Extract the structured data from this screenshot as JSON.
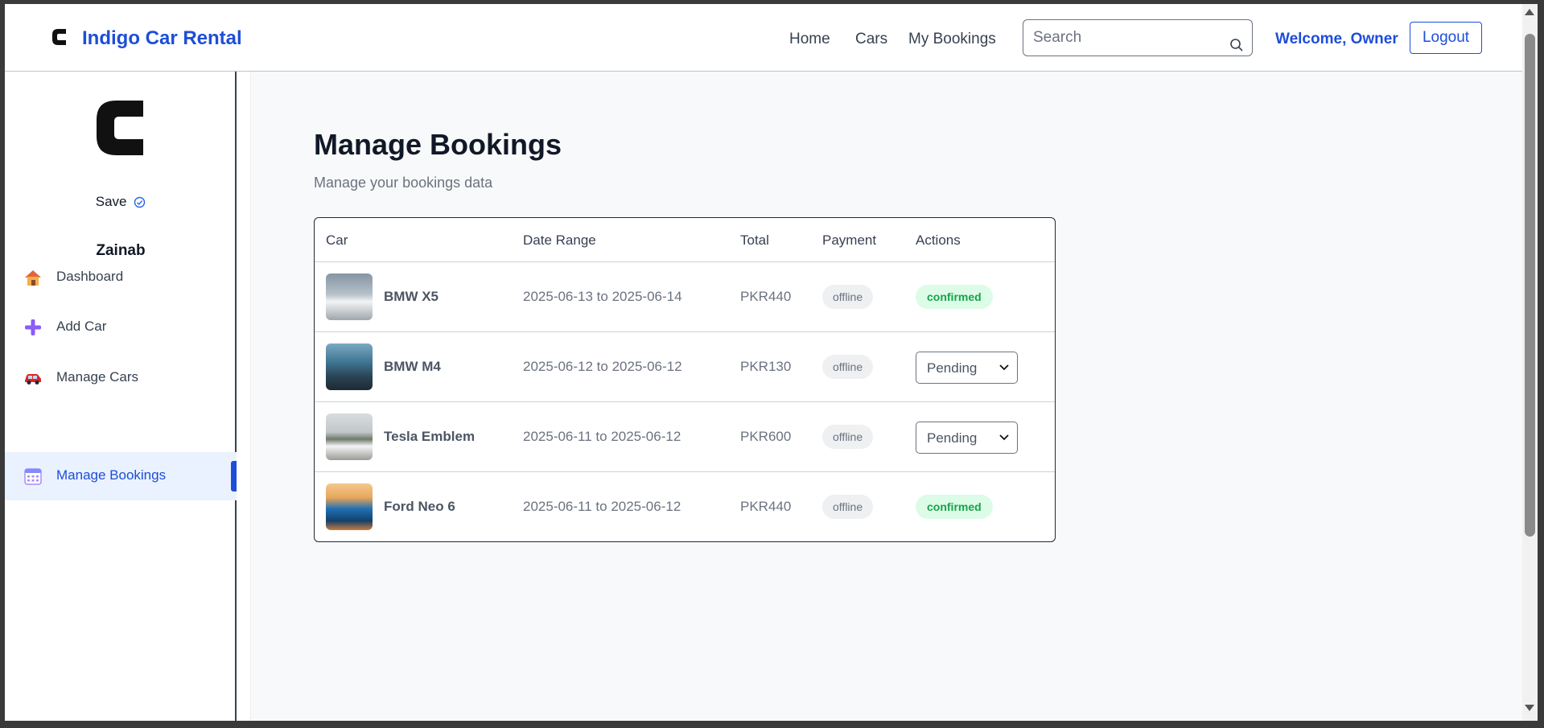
{
  "header": {
    "brand": "Indigo Car Rental",
    "nav": [
      "Home",
      "Cars",
      "My Bookings"
    ],
    "search_placeholder": "Search",
    "welcome": "Welcome, Owner",
    "logout": "Logout"
  },
  "sidebar": {
    "save_label": "Save",
    "user_name": "Zainab",
    "items": [
      {
        "label": "Dashboard",
        "icon": "house-icon"
      },
      {
        "label": "Add Car",
        "icon": "plus-icon"
      },
      {
        "label": "Manage Cars",
        "icon": "car-icon"
      },
      {
        "label": "Manage Bookings",
        "icon": "calendar-icon",
        "active": true
      }
    ]
  },
  "main": {
    "title": "Manage Bookings",
    "subtitle": "Manage your bookings data",
    "columns": [
      "Car",
      "Date Range",
      "Total",
      "Payment",
      "Actions"
    ],
    "rows": [
      {
        "car": "BMW X5",
        "date_range": "2025-06-13 to 2025-06-14",
        "total": "PKR440",
        "payment": "offline",
        "action_type": "badge",
        "action": "confirmed",
        "thumb_colors": [
          "#9aa8b4",
          "#e7ecef"
        ]
      },
      {
        "car": "BMW M4",
        "date_range": "2025-06-12 to 2025-06-12",
        "total": "PKR130",
        "payment": "offline",
        "action_type": "select",
        "action": "Pending",
        "thumb_colors": [
          "#3c6e86",
          "#24394a"
        ]
      },
      {
        "car": "Tesla Emblem",
        "date_range": "2025-06-11 to 2025-06-12",
        "total": "PKR600",
        "payment": "offline",
        "action_type": "select",
        "action": "Pending",
        "thumb_colors": [
          "#c9cfd3",
          "#7c7f78"
        ]
      },
      {
        "car": "Ford Neo 6",
        "date_range": "2025-06-11 to 2025-06-12",
        "total": "PKR440",
        "payment": "offline",
        "action_type": "badge",
        "action": "confirmed",
        "thumb_colors": [
          "#1f6fb5",
          "#d98a3c"
        ]
      }
    ]
  },
  "colors": {
    "accent": "#1d4ed8",
    "confirmed_bg": "#dcfce7",
    "confirmed_text": "#16a34a",
    "active_bg": "#eaf2ff"
  }
}
